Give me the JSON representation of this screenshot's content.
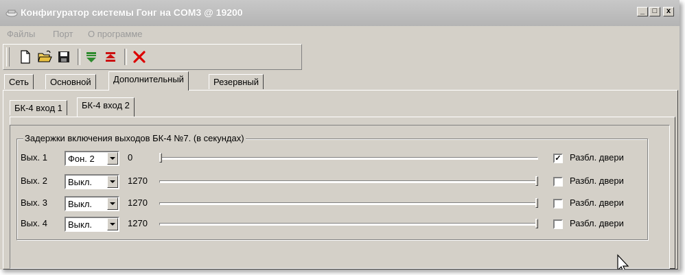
{
  "window": {
    "title": "Конфигуратор системы Гонг на COM3 @ 19200",
    "controls": {
      "minimize": "_",
      "maximize": "□",
      "close": "x"
    }
  },
  "menu": {
    "items": [
      "Файлы",
      "Порт",
      "О программе"
    ]
  },
  "toolbar": {
    "buttons": [
      "new-file-icon",
      "open-folder-icon",
      "save-icon",
      "download-green-icon",
      "upload-red-icon",
      "delete-x-icon"
    ]
  },
  "tabs": {
    "items": [
      "Сеть",
      "Основной",
      "Дополнительный",
      "Резервный"
    ],
    "active": "Дополнительный"
  },
  "subtabs": {
    "items": [
      "БК-4 вход 1",
      "БК-4 вход 2"
    ],
    "active": "БК-4 вход 2"
  },
  "group": {
    "title": "Задержки включения выходов БК-4 №7. (в секундах)",
    "rows": [
      {
        "label": "Вых. 1",
        "mode": "Фон. 2",
        "value": "0",
        "level": 0,
        "checked": true,
        "checkbox_label": "Разбл. двери"
      },
      {
        "label": "Вых. 2",
        "mode": "Выкл.",
        "value": "1270",
        "level": 1,
        "checked": false,
        "checkbox_label": "Разбл. двери"
      },
      {
        "label": "Вых. 3",
        "mode": "Выкл.",
        "value": "1270",
        "level": 1,
        "checked": false,
        "checkbox_label": "Разбл. двери"
      },
      {
        "label": "Вых. 4",
        "mode": "Выкл.",
        "value": "1270",
        "level": 1,
        "checked": false,
        "checkbox_label": "Разбл. двери"
      }
    ]
  },
  "colors": {
    "face": "#d4d0c8",
    "title_bg": "#b8b8b8",
    "menu_disabled": "#9a9a9a",
    "green_icon": "#2e8b2e",
    "red_icon": "#cc1111"
  }
}
